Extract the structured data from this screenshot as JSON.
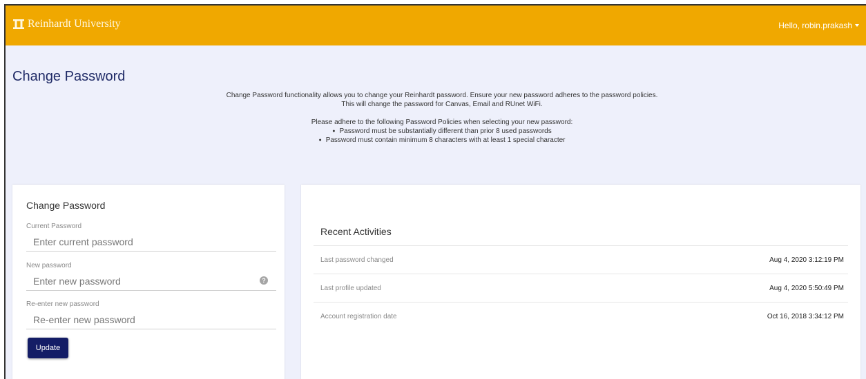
{
  "header": {
    "brand": "Reinhardt University",
    "user_greeting": "Hello, robin.prakash"
  },
  "page": {
    "title": "Change Password",
    "intro_line1": "Change Password functionality allows you to change your Reinhardt password. Ensure your new password adheres to the password policies.",
    "intro_line2": "This will change the password for Canvas, Email and RUnet WiFi.",
    "policy_heading": "Please adhere to the following Password Policies when selecting your new password:",
    "policies": [
      "Password must be substantially different than prior 8 used passwords",
      "Password must contain minimum 8  characters with at least 1 special character"
    ]
  },
  "form": {
    "title": "Change Password",
    "current_label": "Current Password",
    "current_placeholder": "Enter current password",
    "new_label": "New password",
    "new_placeholder": "Enter new password",
    "confirm_label": "Re-enter new password",
    "confirm_placeholder": "Re-enter new password",
    "update_label": "Update"
  },
  "activities": {
    "title": "Recent Activities",
    "rows": [
      {
        "label": "Last password changed",
        "value": "Aug 4, 2020 3:12:19 PM"
      },
      {
        "label": "Last profile updated",
        "value": "Aug 4, 2020 5:50:49 PM"
      },
      {
        "label": "Account registration date",
        "value": "Oct 16, 2018 3:34:12 PM"
      }
    ]
  },
  "colors": {
    "header_bg": "#f0a800",
    "page_bg": "#eef0fb",
    "title_color": "#1f2a66",
    "button_bg": "#141d66"
  },
  "icons": {
    "brand": "university-pillars-icon",
    "user_menu": "caret-down-icon",
    "password_hint": "info-icon"
  }
}
